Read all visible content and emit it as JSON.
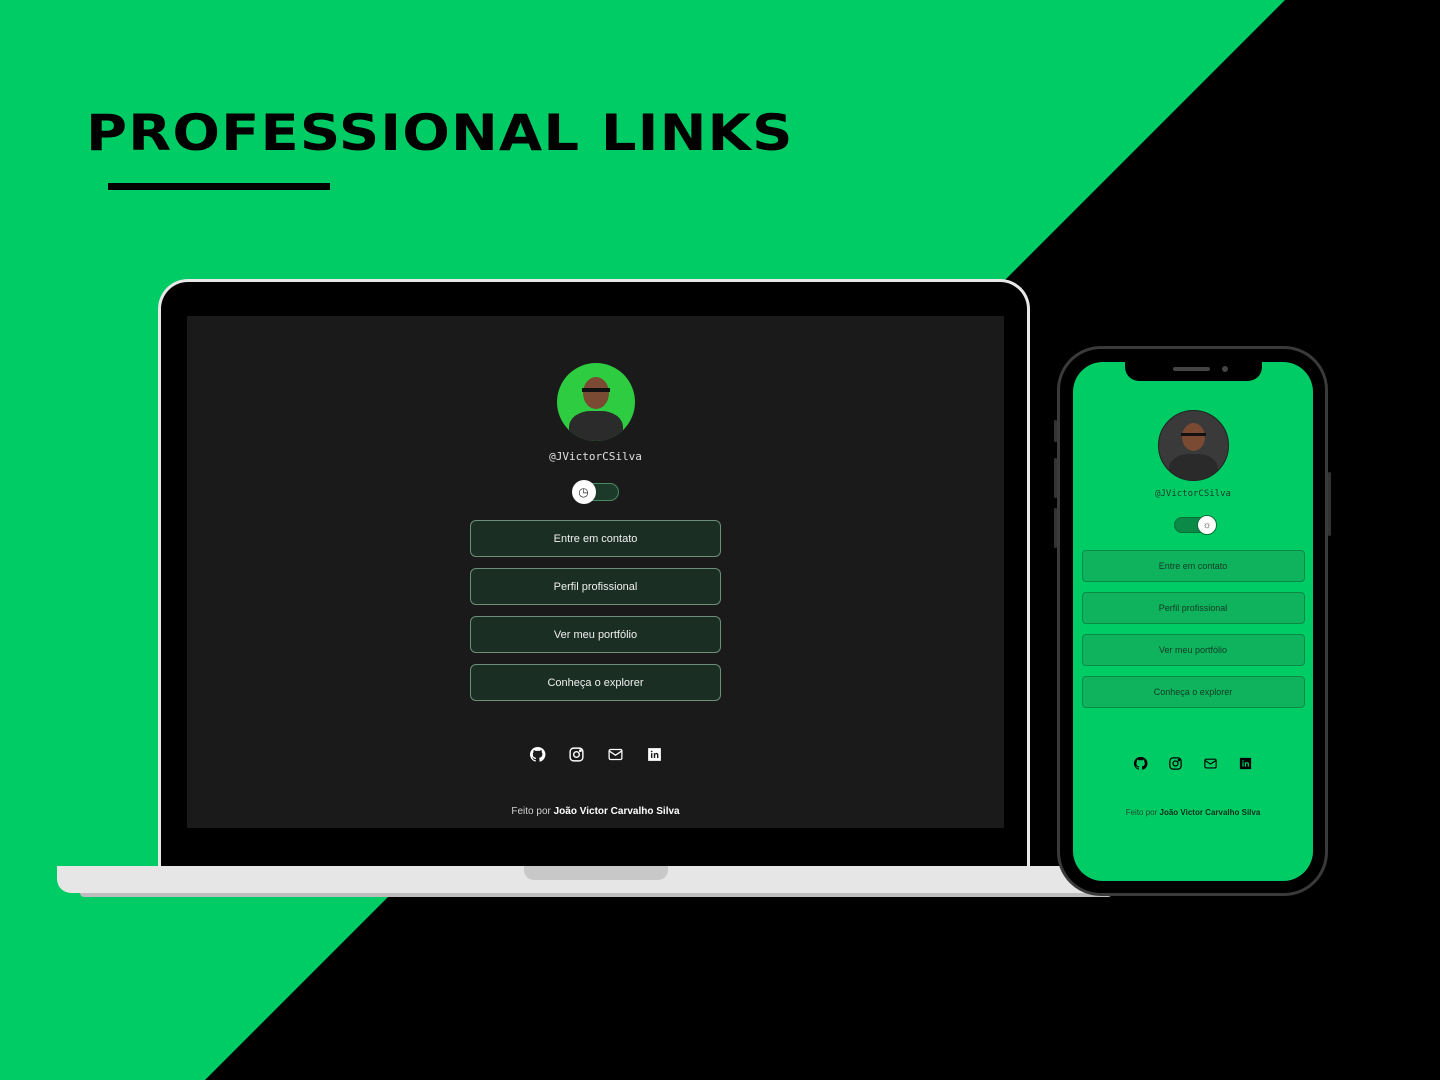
{
  "hero": {
    "title": "PROFESSIONAL LINKS"
  },
  "profile": {
    "handle": "@JVictorCSilva",
    "links": [
      "Entre em contato",
      "Perfil profissional",
      "Ver meu portfólio",
      "Conheça o explorer"
    ],
    "socials": [
      "github-icon",
      "instagram-icon",
      "mail-icon",
      "linkedin-icon"
    ],
    "footer_prefix": "Feito por",
    "footer_author": "João Victor Carvalho Silva"
  },
  "colors": {
    "accent": "#00cc66",
    "dark_bg": "#1a1a1a",
    "black": "#000000"
  },
  "laptop": {
    "theme_icon": "◷"
  },
  "phone": {
    "theme_icon": "☼"
  }
}
